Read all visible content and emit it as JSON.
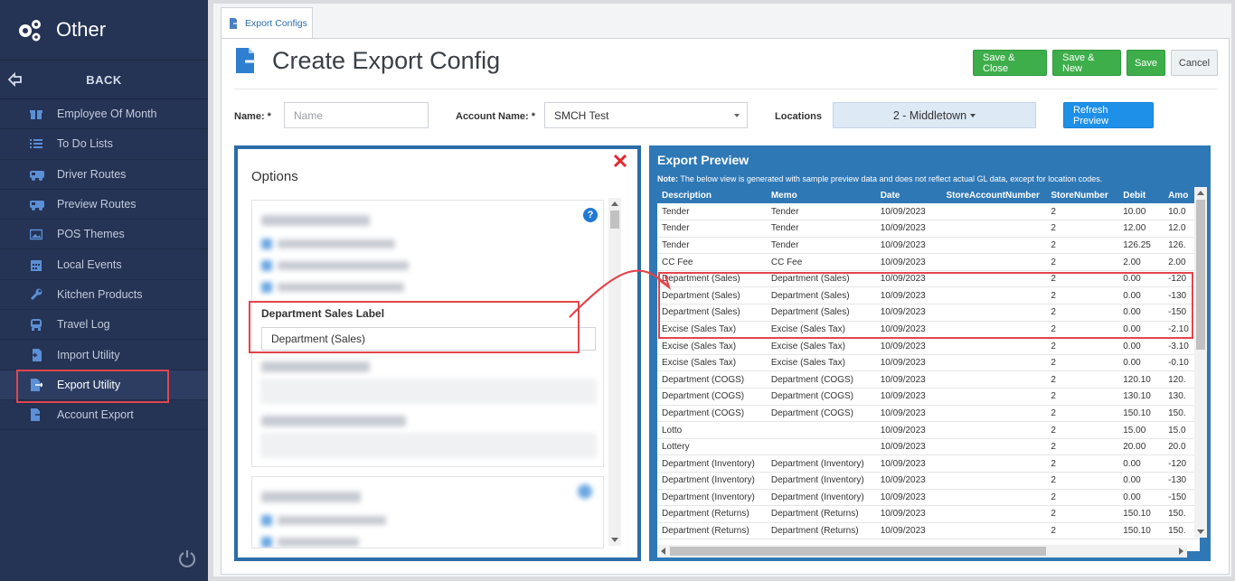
{
  "sidebar": {
    "title": "Other",
    "back_label": "BACK",
    "items": [
      {
        "label": "Employee Of Month",
        "icon": "gift-icon"
      },
      {
        "label": "To Do Lists",
        "icon": "list-icon"
      },
      {
        "label": "Driver Routes",
        "icon": "truck-icon"
      },
      {
        "label": "Preview Routes",
        "icon": "truck-icon"
      },
      {
        "label": "POS Themes",
        "icon": "image-icon"
      },
      {
        "label": "Local Events",
        "icon": "calendar-icon"
      },
      {
        "label": "Kitchen Products",
        "icon": "wrench-icon"
      },
      {
        "label": "Travel Log",
        "icon": "bus-icon"
      },
      {
        "label": "Import Utility",
        "icon": "file-import-icon"
      },
      {
        "label": "Export Utility",
        "icon": "file-export-icon",
        "active": true
      },
      {
        "label": "Account Export",
        "icon": "file-export-icon"
      }
    ]
  },
  "tab": {
    "label": "Export Configs"
  },
  "page": {
    "title": "Create Export Config"
  },
  "toolbar": {
    "save_close": "Save & Close",
    "save_new": "Save & New",
    "save": "Save",
    "cancel": "Cancel"
  },
  "form": {
    "name_label": "Name: *",
    "name_placeholder": "Name",
    "account_label": "Account Name: *",
    "account_value": "SMCH Test",
    "locations_label": "Locations",
    "locations_value": "2 - Middletown",
    "refresh_label": "Refresh Preview"
  },
  "options": {
    "title": "Options",
    "dept_sales_label": "Department Sales Label",
    "dept_sales_value": "Department (Sales)"
  },
  "preview": {
    "title": "Export Preview",
    "note_prefix": "Note:",
    "note_text": " The below view is generated with sample preview data and does not reflect actual GL data, except for location codes.",
    "columns": [
      "Description",
      "Memo",
      "Date",
      "StoreAccountNumber",
      "StoreNumber",
      "Debit",
      "Amo"
    ],
    "rows": [
      [
        "Tender",
        "Tender",
        "10/09/2023",
        "",
        "2",
        "10.00",
        "10.0"
      ],
      [
        "Tender",
        "Tender",
        "10/09/2023",
        "",
        "2",
        "12.00",
        "12.0"
      ],
      [
        "Tender",
        "Tender",
        "10/09/2023",
        "",
        "2",
        "126.25",
        "126."
      ],
      [
        "CC Fee",
        "CC Fee",
        "10/09/2023",
        "",
        "2",
        "2.00",
        "2.00"
      ],
      [
        "Department (Sales)",
        "Department (Sales)",
        "10/09/2023",
        "",
        "2",
        "0.00",
        "-120"
      ],
      [
        "Department (Sales)",
        "Department (Sales)",
        "10/09/2023",
        "",
        "2",
        "0.00",
        "-130"
      ],
      [
        "Department (Sales)",
        "Department (Sales)",
        "10/09/2023",
        "",
        "2",
        "0.00",
        "-150"
      ],
      [
        "Excise (Sales Tax)",
        "Excise (Sales Tax)",
        "10/09/2023",
        "",
        "2",
        "0.00",
        "-2.10"
      ],
      [
        "Excise (Sales Tax)",
        "Excise (Sales Tax)",
        "10/09/2023",
        "",
        "2",
        "0.00",
        "-3.10"
      ],
      [
        "Excise (Sales Tax)",
        "Excise (Sales Tax)",
        "10/09/2023",
        "",
        "2",
        "0.00",
        "-0.10"
      ],
      [
        "Department (COGS)",
        "Department (COGS)",
        "10/09/2023",
        "",
        "2",
        "120.10",
        "120."
      ],
      [
        "Department (COGS)",
        "Department (COGS)",
        "10/09/2023",
        "",
        "2",
        "130.10",
        "130."
      ],
      [
        "Department (COGS)",
        "Department (COGS)",
        "10/09/2023",
        "",
        "2",
        "150.10",
        "150."
      ],
      [
        "Lotto",
        "",
        "10/09/2023",
        "",
        "2",
        "15.00",
        "15.0"
      ],
      [
        "Lottery",
        "",
        "10/09/2023",
        "",
        "2",
        "20.00",
        "20.0"
      ],
      [
        "Department (Inventory)",
        "Department (Inventory)",
        "10/09/2023",
        "",
        "2",
        "0.00",
        "-120"
      ],
      [
        "Department (Inventory)",
        "Department (Inventory)",
        "10/09/2023",
        "",
        "2",
        "0.00",
        "-130"
      ],
      [
        "Department (Inventory)",
        "Department (Inventory)",
        "10/09/2023",
        "",
        "2",
        "0.00",
        "-150"
      ],
      [
        "Department (Returns)",
        "Department (Returns)",
        "10/09/2023",
        "",
        "2",
        "150.10",
        "150."
      ],
      [
        "Department (Returns)",
        "Department (Returns)",
        "10/09/2023",
        "",
        "2",
        "150.10",
        "150."
      ]
    ]
  },
  "colors": {
    "sidebar_bg": "#253354",
    "accent_blue": "#2f78b6",
    "save_green": "#3dae4a",
    "highlight_red": "#e2454b",
    "refresh_blue": "#1e90e8"
  }
}
